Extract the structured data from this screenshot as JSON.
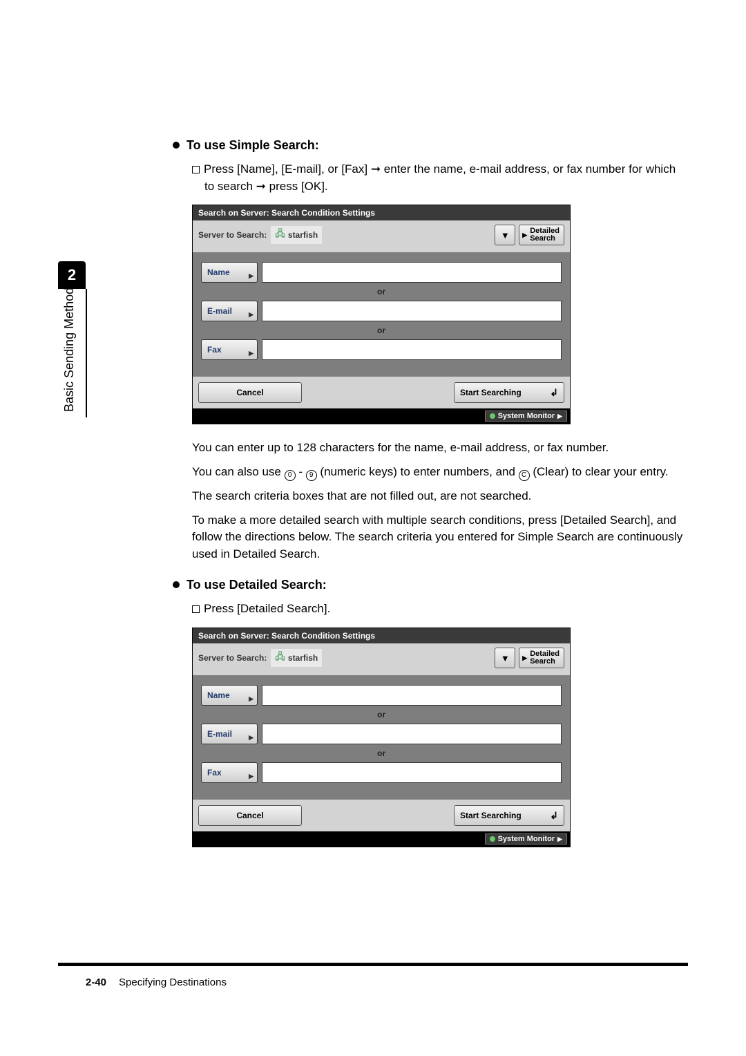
{
  "side": {
    "chapter_num": "2",
    "vertical_label": "Basic Sending Methods"
  },
  "section1": {
    "heading": "To use Simple Search:",
    "instruction_a": "Press [Name], [E-mail], or [Fax] ",
    "instruction_b": " enter the name, e-mail address, or fax number for which to search ",
    "instruction_c": " press [OK].",
    "arrow": "➞",
    "p1": "You can enter up to 128 characters for the name, e-mail address, or fax number.",
    "p2a": "You can also use ",
    "p2b": " - ",
    "p2c": " (numeric keys) to enter numbers, and ",
    "p2d": " (Clear) to clear your entry.",
    "key0": "0",
    "key9": "9",
    "keyC": "C",
    "p3": "The search criteria boxes that are not filled out, are not searched.",
    "p4": "To make a more detailed search with multiple search conditions, press [Detailed Search], and follow the directions below. The search criteria you entered for Simple Search are continuously used in Detailed Search."
  },
  "section2": {
    "heading": "To use Detailed Search:",
    "instruction": "Press [Detailed Search]."
  },
  "panel": {
    "title": "Search on Server: Search Condition Settings",
    "server_label": "Server to Search:",
    "server_value": "starfish",
    "detailed_btn": "Detailed\nSearch",
    "name_btn": "Name",
    "email_btn": "E-mail",
    "fax_btn": "Fax",
    "or": "or",
    "cancel": "Cancel",
    "start": "Start Searching",
    "sysmon": "System Monitor"
  },
  "footer": {
    "page": "2-40",
    "title": "Specifying Destinations"
  }
}
